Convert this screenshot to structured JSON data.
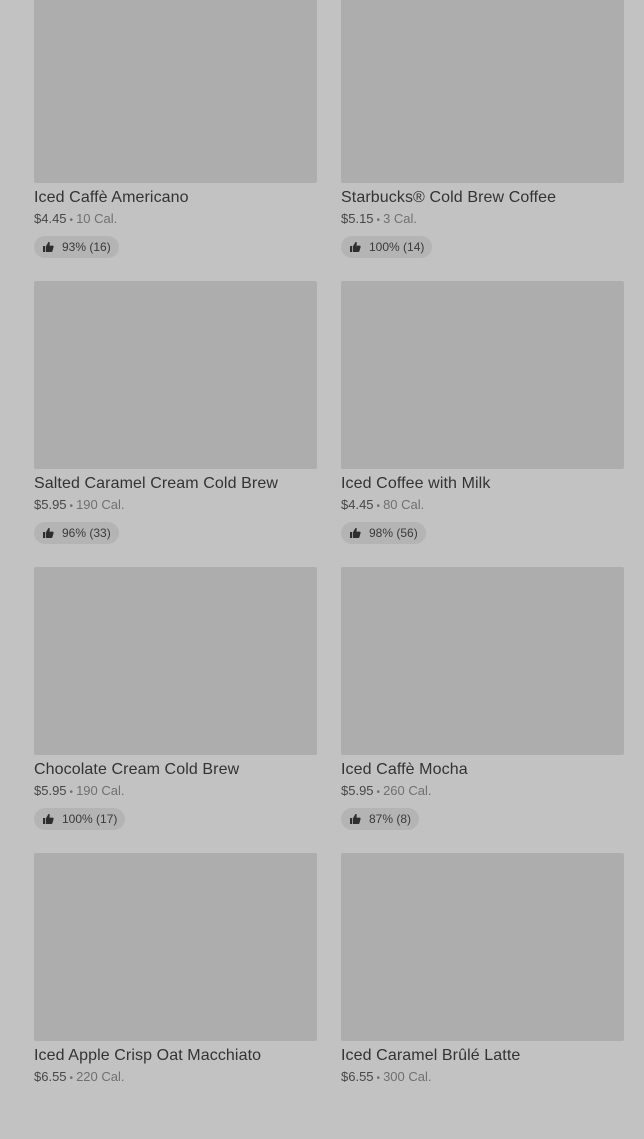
{
  "products": [
    {
      "name": "Iced Caffè Americano",
      "price": "$4.45",
      "calories": "10 Cal.",
      "rating": "93% (16)"
    },
    {
      "name": "Starbucks® Cold Brew Coffee",
      "price": "$5.15",
      "calories": "3 Cal.",
      "rating": "100% (14)"
    },
    {
      "name": "Salted Caramel Cream Cold Brew",
      "price": "$5.95",
      "calories": "190 Cal.",
      "rating": "96% (33)"
    },
    {
      "name": "Iced Coffee with Milk",
      "price": "$4.45",
      "calories": "80 Cal.",
      "rating": "98% (56)"
    },
    {
      "name": "Chocolate Cream Cold Brew",
      "price": "$5.95",
      "calories": "190 Cal.",
      "rating": "100% (17)"
    },
    {
      "name": "Iced Caffè Mocha",
      "price": "$5.95",
      "calories": "260 Cal.",
      "rating": "87% (8)"
    },
    {
      "name": "Iced Apple Crisp Oat Macchiato",
      "price": "$6.55",
      "calories": "220 Cal.",
      "rating": ""
    },
    {
      "name": "Iced Caramel Brûlé Latte",
      "price": "$6.55",
      "calories": "300 Cal.",
      "rating": ""
    }
  ],
  "separator": "•",
  "icons": {
    "rating": "thumbs-up-icon"
  },
  "colors": {
    "background": "#c2c2c2",
    "image_placeholder": "#adadad",
    "rating_pill": "#b4b4b4"
  }
}
